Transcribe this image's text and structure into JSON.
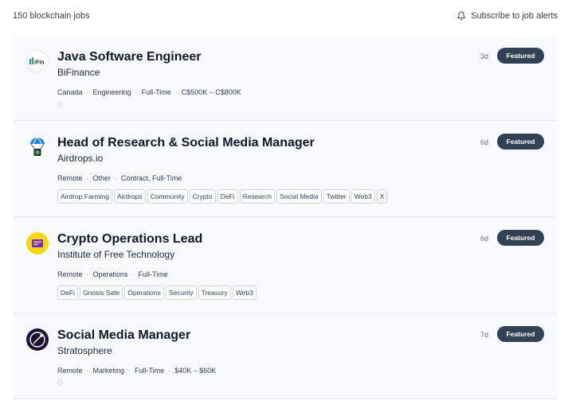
{
  "header": {
    "count_label": "150 blockchain jobs",
    "subscribe_label": "Subscribe to job alerts"
  },
  "jobs": [
    {
      "title": "Java Software Engineer",
      "company": "BiFinance",
      "age": "3d",
      "badge": "Featured",
      "meta": [
        "Canada",
        "Engineering",
        "Full-Time",
        "C$500K – C$800K"
      ],
      "tags": [],
      "logo_icon": "bifinance-logo"
    },
    {
      "title": "Head of Research & Social Media Manager",
      "company": "Airdrops.io",
      "age": "6d",
      "badge": "Featured",
      "meta": [
        "Remote",
        "Other",
        "Contract, Full-Time"
      ],
      "tags": [
        "Airdrop Farming",
        "Airdrops",
        "Community",
        "Crypto",
        "DeFi",
        "Research",
        "Social Media",
        "Twitter",
        "Web3",
        "X"
      ],
      "logo_icon": "parachute-logo"
    },
    {
      "title": "Crypto Operations Lead",
      "company": "Institute of Free Technology",
      "age": "6d",
      "badge": "Featured",
      "meta": [
        "Remote",
        "Operations",
        "Full-Time"
      ],
      "tags": [
        "DeFi",
        "Gnosis Safe",
        "Operations",
        "Security",
        "Treasury",
        "Web3"
      ],
      "logo_icon": "ift-logo"
    },
    {
      "title": "Social Media Manager",
      "company": "Stratosphere",
      "age": "7d",
      "badge": "Featured",
      "meta": [
        "Remote",
        "Marketing",
        "Full-Time",
        "$40K – $60K"
      ],
      "tags": [],
      "logo_icon": "stratosphere-logo"
    }
  ],
  "colors": {
    "badge_bg": "#334155",
    "card_bg": "#f8f9fa",
    "ift_yellow": "#f5d90a"
  }
}
